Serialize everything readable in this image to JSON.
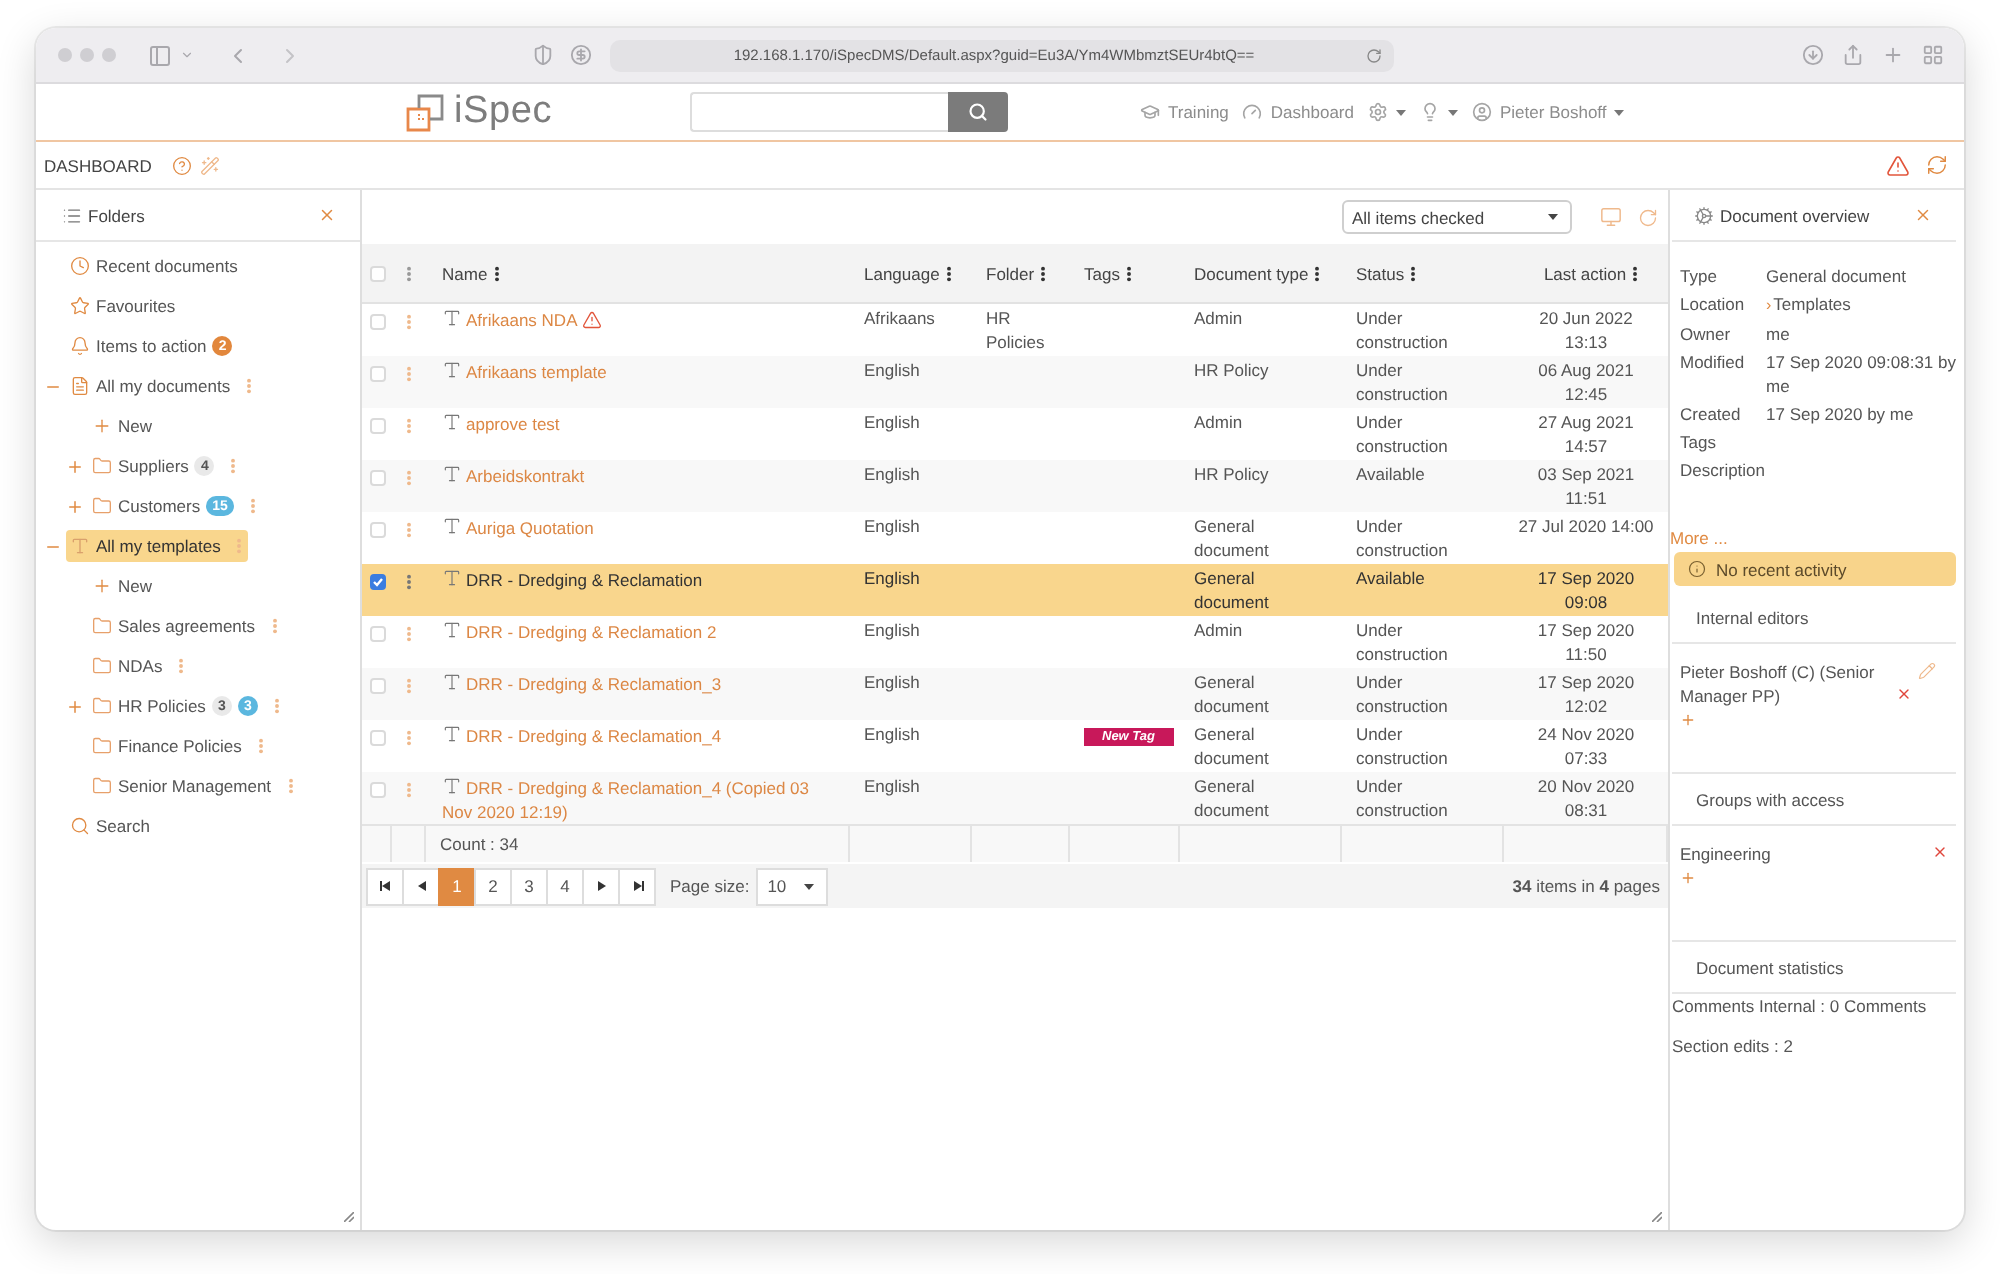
{
  "browser": {
    "url": "192.168.1.170/iSpecDMS/Default.aspx?guid=Eu3A/Ym4WMbmztSEUr4btQ=="
  },
  "header": {
    "logo": "iSpec",
    "nav": [
      {
        "kind": "training",
        "label": "Training",
        "dropdown": false
      },
      {
        "kind": "dashboard",
        "label": "Dashboard",
        "dropdown": false
      },
      {
        "kind": "settings",
        "dropdown": true
      },
      {
        "kind": "help",
        "dropdown": true
      },
      {
        "kind": "user",
        "label": "Pieter Boshoff",
        "dropdown": true
      }
    ]
  },
  "page": {
    "title": "DASHBOARD"
  },
  "folders": {
    "title": "Folders",
    "tree": [
      {
        "kind": "recent",
        "label": "Recent documents",
        "selected": false
      },
      {
        "kind": "favourites",
        "label": "Favourites",
        "selected": false
      },
      {
        "kind": "actions",
        "label": "Items to action",
        "selected": false,
        "badges": [
          {
            "text": "2",
            "color": "#e2873c"
          }
        ]
      },
      {
        "kind": "documents",
        "label": "All my documents",
        "selected": false,
        "expanded": true,
        "children": [
          {
            "kind": "new",
            "label": "New",
            "selected": false
          },
          {
            "kind": "folder",
            "label": "Suppliers",
            "selected": false,
            "expanded": false,
            "badges": [
              {
                "text": "4",
                "color": "#e9e9e9"
              }
            ]
          },
          {
            "kind": "folder",
            "label": "Customers",
            "selected": false,
            "expanded": false,
            "badges": [
              {
                "text": "15",
                "color": "#5bb7df"
              }
            ]
          }
        ]
      },
      {
        "kind": "templates",
        "label": "All my templates",
        "selected": true,
        "expanded": true,
        "children": [
          {
            "kind": "new",
            "label": "New",
            "selected": false
          },
          {
            "kind": "folder",
            "label": "Sales agreements",
            "selected": false
          },
          {
            "kind": "folder",
            "label": "NDAs",
            "selected": false
          },
          {
            "kind": "folder",
            "label": "HR Policies",
            "selected": false,
            "expanded": false,
            "badges": [
              {
                "text": "3",
                "color": "#e9e9e9"
              },
              {
                "text": "3",
                "color": "#5bb7df"
              }
            ]
          },
          {
            "kind": "folder",
            "label": "Finance Policies",
            "selected": false
          },
          {
            "kind": "folder",
            "label": "Senior Management",
            "selected": false
          }
        ]
      },
      {
        "kind": "search",
        "label": "Search",
        "selected": false
      }
    ]
  },
  "documents": {
    "filter": "All items checked",
    "select_all": {
      "checked": false
    },
    "columns": [
      {
        "label": "Name"
      },
      {
        "label": "Language"
      },
      {
        "label": "Folder"
      },
      {
        "label": "Tags"
      },
      {
        "label": "Document type"
      },
      {
        "label": "Status"
      },
      {
        "label": "Last action"
      }
    ],
    "rows": [
      {
        "checked": false,
        "selected": false,
        "name": "Afrikaans NDA",
        "warning": true,
        "language": "Afrikaans",
        "folder": "HR Policies",
        "document_type": "Admin",
        "status": "Under construction",
        "last_action": "20 Jun 2022 13:13"
      },
      {
        "checked": false,
        "selected": false,
        "name": "Afrikaans template",
        "warning": false,
        "language": "English",
        "document_type": "HR Policy",
        "status": "Under construction",
        "last_action": "06 Aug 2021 12:45"
      },
      {
        "checked": false,
        "selected": false,
        "name": "approve test",
        "warning": false,
        "language": "English",
        "document_type": "Admin",
        "status": "Under construction",
        "last_action": "27 Aug 2021 14:57"
      },
      {
        "checked": false,
        "selected": false,
        "name": "Arbeidskontrakt",
        "warning": false,
        "language": "English",
        "document_type": "HR Policy",
        "status": "Available",
        "last_action": "03 Sep 2021 11:51"
      },
      {
        "checked": false,
        "selected": false,
        "name": "Auriga Quotation",
        "warning": false,
        "language": "English",
        "document_type": "General document",
        "status": "Under construction",
        "last_action": "27 Jul 2020 14:00"
      },
      {
        "checked": true,
        "selected": true,
        "name": "DRR - Dredging & Reclamation",
        "warning": false,
        "language": "English",
        "document_type": "General document",
        "status": "Available",
        "last_action": "17 Sep 2020 09:08"
      },
      {
        "checked": false,
        "selected": false,
        "name": "DRR - Dredging & Reclamation 2",
        "warning": false,
        "language": "English",
        "document_type": "Admin",
        "status": "Under construction",
        "last_action": "17 Sep 2020 11:50"
      },
      {
        "checked": false,
        "selected": false,
        "name": "DRR - Dredging & Reclamation_3",
        "warning": false,
        "language": "English",
        "document_type": "General document",
        "status": "Under construction",
        "last_action": "17 Sep 2020 12:02"
      },
      {
        "checked": false,
        "selected": false,
        "name": "DRR - Dredging & Reclamation_4",
        "warning": false,
        "language": "English",
        "tags": [
          {
            "label": "New Tag",
            "color": "#c8185a"
          }
        ],
        "document_type": "General document",
        "status": "Under construction",
        "last_action": "24 Nov 2020 07:33"
      },
      {
        "checked": false,
        "selected": false,
        "name": "DRR - Dredging & Reclamation_4 (Copied 03 Nov 2020 12:19)",
        "warning": false,
        "language": "English",
        "document_type": "General document",
        "status": "Under construction",
        "last_action": "20 Nov 2020 08:31"
      }
    ],
    "count": "Count : 34",
    "pager": {
      "pages": [
        {
          "label": "1",
          "selected": true
        },
        {
          "label": "2",
          "selected": false
        },
        {
          "label": "3",
          "selected": false
        },
        {
          "label": "4",
          "selected": false
        }
      ],
      "page_size_label": "Page size:",
      "page_size": "10",
      "summary": "**34** items in **4** pages"
    }
  },
  "overview": {
    "title": "Document overview",
    "properties": [
      {
        "label": "Type",
        "value": "General document"
      },
      {
        "label": "Location",
        "separator": "›",
        "value": "Templates"
      },
      {
        "label": "Owner",
        "value": "me"
      },
      {
        "label": "Modified",
        "value": "17 Sep 2020 09:08:31 by me"
      },
      {
        "label": "Created",
        "value": "17 Sep 2020 by me"
      },
      {
        "label": "Tags"
      },
      {
        "label": "Description"
      }
    ],
    "more": "More ...",
    "notice": "No recent activity",
    "sections": [
      {
        "kind": "members",
        "title": "Internal editors",
        "entries": [
          {
            "name": "Pieter Boshoff (C) (Senior Manager PP)",
            "editable": true
          }
        ]
      },
      {
        "kind": "members",
        "title": "Groups with access",
        "entries": [
          {
            "name": "Engineering",
            "editable": false
          }
        ]
      },
      {
        "kind": "stats",
        "title": "Document statistics",
        "lines": [
          "Comments Internal : 0 Comments",
          "Section edits : 2"
        ]
      }
    ]
  }
}
